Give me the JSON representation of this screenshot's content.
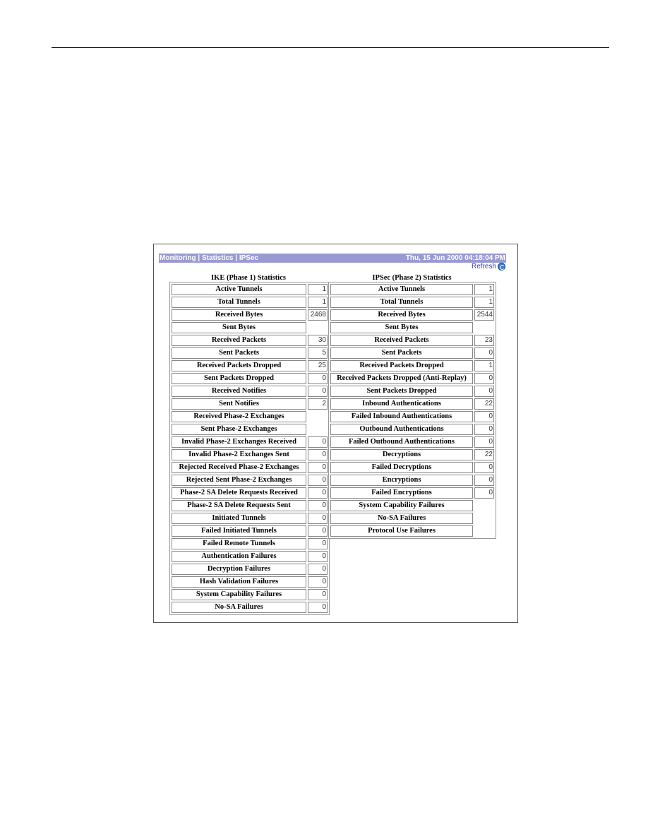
{
  "header": {
    "breadcrumb": [
      "Monitoring",
      "Statistics",
      "IPSec"
    ],
    "separator": " | ",
    "datetime": "Thu, 15 Jun 2000 04:18:04 PM",
    "refresh_label": "Refresh"
  },
  "ike": {
    "title": "IKE (Phase 1) Statistics",
    "rows": [
      {
        "label": "Active Tunnels",
        "value": "1"
      },
      {
        "label": "Total Tunnels",
        "value": "1"
      },
      {
        "label": "Received Bytes",
        "value": "2468"
      },
      {
        "label": "Sent Bytes",
        "value": null
      },
      {
        "label": "Received Packets",
        "value": "30"
      },
      {
        "label": "Sent Packets",
        "value": "5"
      },
      {
        "label": "Received Packets Dropped",
        "value": "25"
      },
      {
        "label": "Sent Packets Dropped",
        "value": "0"
      },
      {
        "label": "Received Notifies",
        "value": "0"
      },
      {
        "label": "Sent Notifies",
        "value": "2"
      },
      {
        "label": "Received Phase-2 Exchanges",
        "value": null
      },
      {
        "label": "Sent Phase-2 Exchanges",
        "value": null
      },
      {
        "label": "Invalid Phase-2 Exchanges Received",
        "value": "0"
      },
      {
        "label": "Invalid Phase-2 Exchanges Sent",
        "value": "0"
      },
      {
        "label": "Rejected Received Phase-2 Exchanges",
        "value": "0"
      },
      {
        "label": "Rejected Sent Phase-2 Exchanges",
        "value": "0"
      },
      {
        "label": "Phase-2 SA Delete Requests Received",
        "value": "0"
      },
      {
        "label": "Phase-2 SA Delete Requests Sent",
        "value": "0"
      },
      {
        "label": "Initiated Tunnels",
        "value": "0"
      },
      {
        "label": "Failed Initiated Tunnels",
        "value": "0"
      },
      {
        "label": "Failed Remote Tunnels",
        "value": "0"
      },
      {
        "label": "Authentication Failures",
        "value": "0"
      },
      {
        "label": "Decryption Failures",
        "value": "0"
      },
      {
        "label": "Hash Validation Failures",
        "value": "0"
      },
      {
        "label": "System Capability Failures",
        "value": "0"
      },
      {
        "label": "No-SA Failures",
        "value": "0"
      }
    ]
  },
  "ipsec": {
    "title": "IPSec (Phase 2) Statistics",
    "rows": [
      {
        "label": "Active Tunnels",
        "value": "1"
      },
      {
        "label": "Total Tunnels",
        "value": "1"
      },
      {
        "label": "Received Bytes",
        "value": "2544"
      },
      {
        "label": "Sent Bytes",
        "value": null
      },
      {
        "label": "Received Packets",
        "value": "23"
      },
      {
        "label": "Sent Packets",
        "value": "0"
      },
      {
        "label": "Received Packets Dropped",
        "value": "1"
      },
      {
        "label": "Received Packets Dropped (Anti-Replay)",
        "value": "0"
      },
      {
        "label": "Sent Packets Dropped",
        "value": "0"
      },
      {
        "label": "Inbound Authentications",
        "value": "22"
      },
      {
        "label": "Failed Inbound Authentications",
        "value": "0"
      },
      {
        "label": "Outbound Authentications",
        "value": "0"
      },
      {
        "label": "Failed Outbound Authentications",
        "value": "0"
      },
      {
        "label": "Decryptions",
        "value": "22"
      },
      {
        "label": "Failed Decryptions",
        "value": "0"
      },
      {
        "label": "Encryptions",
        "value": "0"
      },
      {
        "label": "Failed Encryptions",
        "value": "0"
      },
      {
        "label": "System Capability Failures",
        "value": null
      },
      {
        "label": "No-SA Failures",
        "value": null
      },
      {
        "label": "Protocol Use Failures",
        "value": null
      }
    ]
  },
  "colors": {
    "titlebar": "#9a9ad2",
    "refresh_icon": "#3a7fc8"
  }
}
